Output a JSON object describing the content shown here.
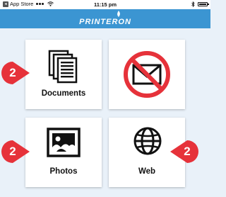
{
  "status_bar": {
    "back_app": "App Store",
    "time": "11:15 pm"
  },
  "header": {
    "logo_text": "PRINTERON"
  },
  "tiles": [
    {
      "label": "Documents",
      "icon": "documents-icon"
    },
    {
      "label": "",
      "icon": "email-disabled-icon"
    },
    {
      "label": "Photos",
      "icon": "photo-icon"
    },
    {
      "label": "Web",
      "icon": "globe-icon"
    }
  ],
  "callouts": [
    "2",
    "2",
    "2"
  ],
  "colors": {
    "header": "#3b95d2",
    "background": "#e9f1f9",
    "callout": "#e6323a",
    "prohibited": "#e6323a"
  }
}
